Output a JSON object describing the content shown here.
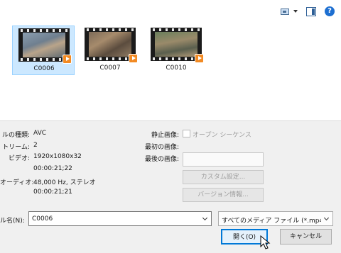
{
  "toolbar": {
    "view_icon": "view-options-icon",
    "view_menu_icon": "chevron-down-icon",
    "preview_pane_icon": "preview-pane-icon",
    "help_label": "?"
  },
  "files": [
    {
      "name": "C0006",
      "selected": true
    },
    {
      "name": "C0007",
      "selected": false
    },
    {
      "name": "C0010",
      "selected": false
    }
  ],
  "info": {
    "type_label": "ルの種類:",
    "type_value": "AVC",
    "stream_label": "トリーム:",
    "stream_value": "2",
    "video_label": "ビデオ:",
    "video_res": "1920x1080x32",
    "video_dur": "00:00:21;22",
    "audio_label": "オーディオ:",
    "audio_val": "48,000 Hz, ステレオ",
    "audio_dur": "00:00:21;21"
  },
  "options": {
    "still_label": "静止画像:",
    "open_sequence_label": "オープン シーケンス",
    "first_image_label": "最初の画像:",
    "last_image_label": "最後の画像:",
    "custom_settings_button": "カスタム設定...",
    "version_info_button": "バージョン情報..."
  },
  "file_name": {
    "label": "ル名(N):",
    "value": "C0006"
  },
  "file_type": {
    "selected": "すべてのメディア ファイル (*.mp4;*.n"
  },
  "buttons": {
    "open": "開く(O)",
    "cancel": "キャンセル"
  }
}
